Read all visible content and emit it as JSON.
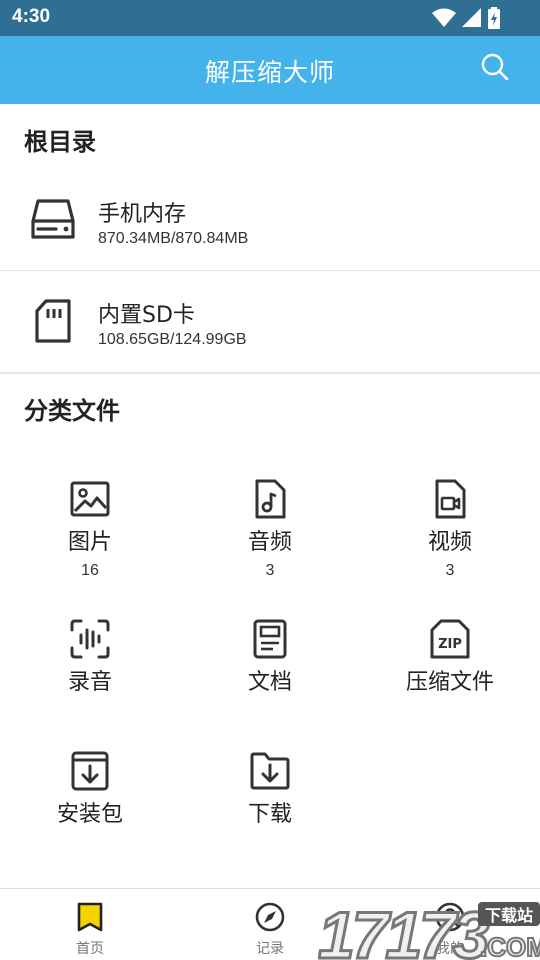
{
  "status_bar": {
    "time": "4:30"
  },
  "app_bar": {
    "title": "解压缩大师"
  },
  "root_section": {
    "title": "根目录",
    "items": [
      {
        "name": "手机内存",
        "size": "870.34MB/870.84MB",
        "icon": "hard-drive-icon"
      },
      {
        "name": "内置SD卡",
        "size": "108.65GB/124.99GB",
        "icon": "sd-card-icon"
      }
    ]
  },
  "category_section": {
    "title": "分类文件",
    "items": [
      {
        "label": "图片",
        "count": "16",
        "icon": "image-icon"
      },
      {
        "label": "音频",
        "count": "3",
        "icon": "audio-file-icon"
      },
      {
        "label": "视频",
        "count": "3",
        "icon": "video-file-icon"
      },
      {
        "label": "录音",
        "icon": "recording-icon"
      },
      {
        "label": "文档",
        "icon": "document-icon"
      },
      {
        "label": "压缩文件",
        "icon": "zip-file-icon"
      },
      {
        "label": "安装包",
        "icon": "package-icon"
      },
      {
        "label": "下载",
        "icon": "download-folder-icon"
      }
    ]
  },
  "bottom_nav": {
    "items": [
      {
        "label": "首页",
        "icon": "bookmark-icon",
        "active": true
      },
      {
        "label": "记录",
        "icon": "compass-icon",
        "active": false
      },
      {
        "label": "我的",
        "icon": "profile-icon",
        "active": false
      }
    ]
  },
  "watermark": {
    "text": "17173",
    "badge": "下载站",
    "suffix": ".COM"
  },
  "colors": {
    "status_bar": "#2f6f93",
    "app_bar": "#44b3ec",
    "active_nav": "#f5d300",
    "icon": "#333333"
  }
}
